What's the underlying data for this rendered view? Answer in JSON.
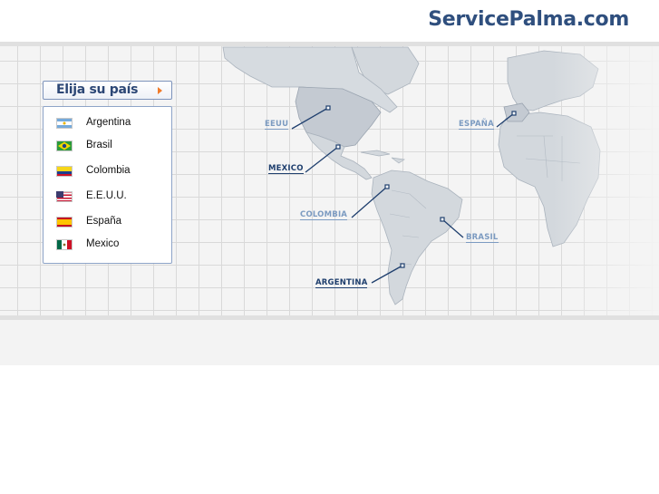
{
  "header": {
    "logo_text": "ServicePalma.com"
  },
  "selector": {
    "title": "Elija su país",
    "arrow_icon": "triangle-right-icon",
    "arrow_color": "#f07b2a"
  },
  "countries": [
    {
      "name": "Argentina",
      "flag": "argentina-flag-icon"
    },
    {
      "name": "Brasil",
      "flag": "brazil-flag-icon"
    },
    {
      "name": "Colombia",
      "flag": "colombia-flag-icon"
    },
    {
      "name": "E.E.U.U.",
      "flag": "usa-flag-icon"
    },
    {
      "name": "España",
      "flag": "spain-flag-icon"
    },
    {
      "name": "Mexico",
      "flag": "mexico-flag-icon"
    }
  ],
  "map_labels": {
    "eeuu": "EEUU",
    "mexico": "MEXICO",
    "colombia": "COLOMBIA",
    "brasil": "BRASIL",
    "argentina": "ARGENTINA",
    "espana": "ESPAÑA"
  },
  "colors": {
    "brand": "#2f4f7e",
    "land": "#d3d8dd",
    "land_highlight": "#c4cad2",
    "label_light": "#7c9bc1",
    "label_dark": "#1f3f6e"
  }
}
